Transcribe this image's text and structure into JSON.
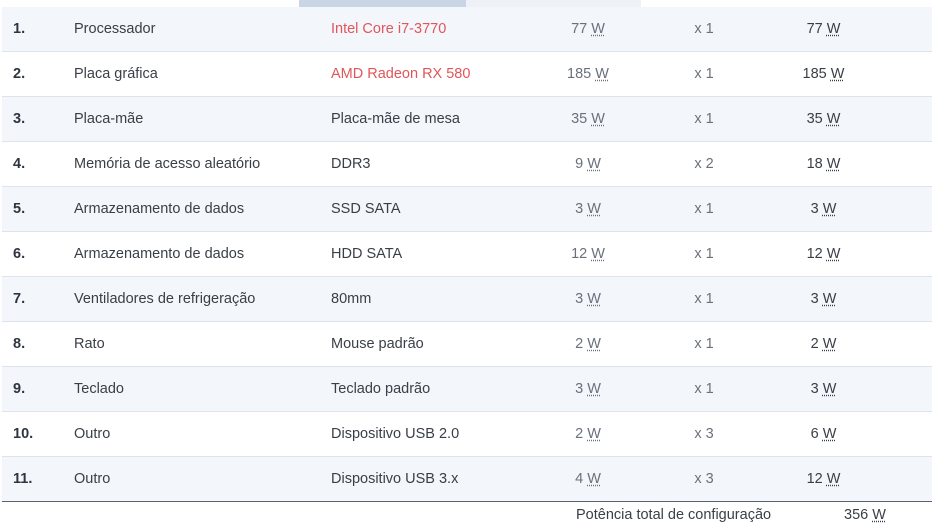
{
  "rows": [
    {
      "index": "1.",
      "component": "Processador",
      "model": "Intel Core i7-3770",
      "model_is_link": true,
      "watt": "77",
      "qty": "x 1",
      "total": "77"
    },
    {
      "index": "2.",
      "component": "Placa gráfica",
      "model": "AMD Radeon RX 580",
      "model_is_link": true,
      "watt": "185",
      "qty": "x 1",
      "total": "185"
    },
    {
      "index": "3.",
      "component": "Placa-mãe",
      "model": "Placa-mãe de mesa",
      "model_is_link": false,
      "watt": "35",
      "qty": "x 1",
      "total": "35"
    },
    {
      "index": "4.",
      "component": "Memória de acesso aleatório",
      "model": "DDR3",
      "model_is_link": false,
      "watt": "9",
      "qty": "x 2",
      "total": "18"
    },
    {
      "index": "5.",
      "component": "Armazenamento de dados",
      "model": "SSD SATA",
      "model_is_link": false,
      "watt": "3",
      "qty": "x 1",
      "total": "3"
    },
    {
      "index": "6.",
      "component": "Armazenamento de dados",
      "model": "HDD SATA",
      "model_is_link": false,
      "watt": "12",
      "qty": "x 1",
      "total": "12"
    },
    {
      "index": "7.",
      "component": "Ventiladores de refrigeração",
      "model": "80mm",
      "model_is_link": false,
      "watt": "3",
      "qty": "x 1",
      "total": "3"
    },
    {
      "index": "8.",
      "component": "Rato",
      "model": "Mouse padrão",
      "model_is_link": false,
      "watt": "2",
      "qty": "x 1",
      "total": "2"
    },
    {
      "index": "9.",
      "component": "Teclado",
      "model": "Teclado padrão",
      "model_is_link": false,
      "watt": "3",
      "qty": "x 1",
      "total": "3"
    },
    {
      "index": "10.",
      "component": "Outro",
      "model": "Dispositivo USB 2.0",
      "model_is_link": false,
      "watt": "2",
      "qty": "x 3",
      "total": "6"
    },
    {
      "index": "11.",
      "component": "Outro",
      "model": "Dispositivo USB 3.x",
      "model_is_link": false,
      "watt": "4",
      "qty": "x 3",
      "total": "12"
    }
  ],
  "unit": "W",
  "summary": {
    "label": "Potência total de configuração",
    "value": "356"
  },
  "colors": {
    "link": "#e0565b",
    "row_alt": "#f3f6fa",
    "tab_active": "#c9d4e4"
  }
}
